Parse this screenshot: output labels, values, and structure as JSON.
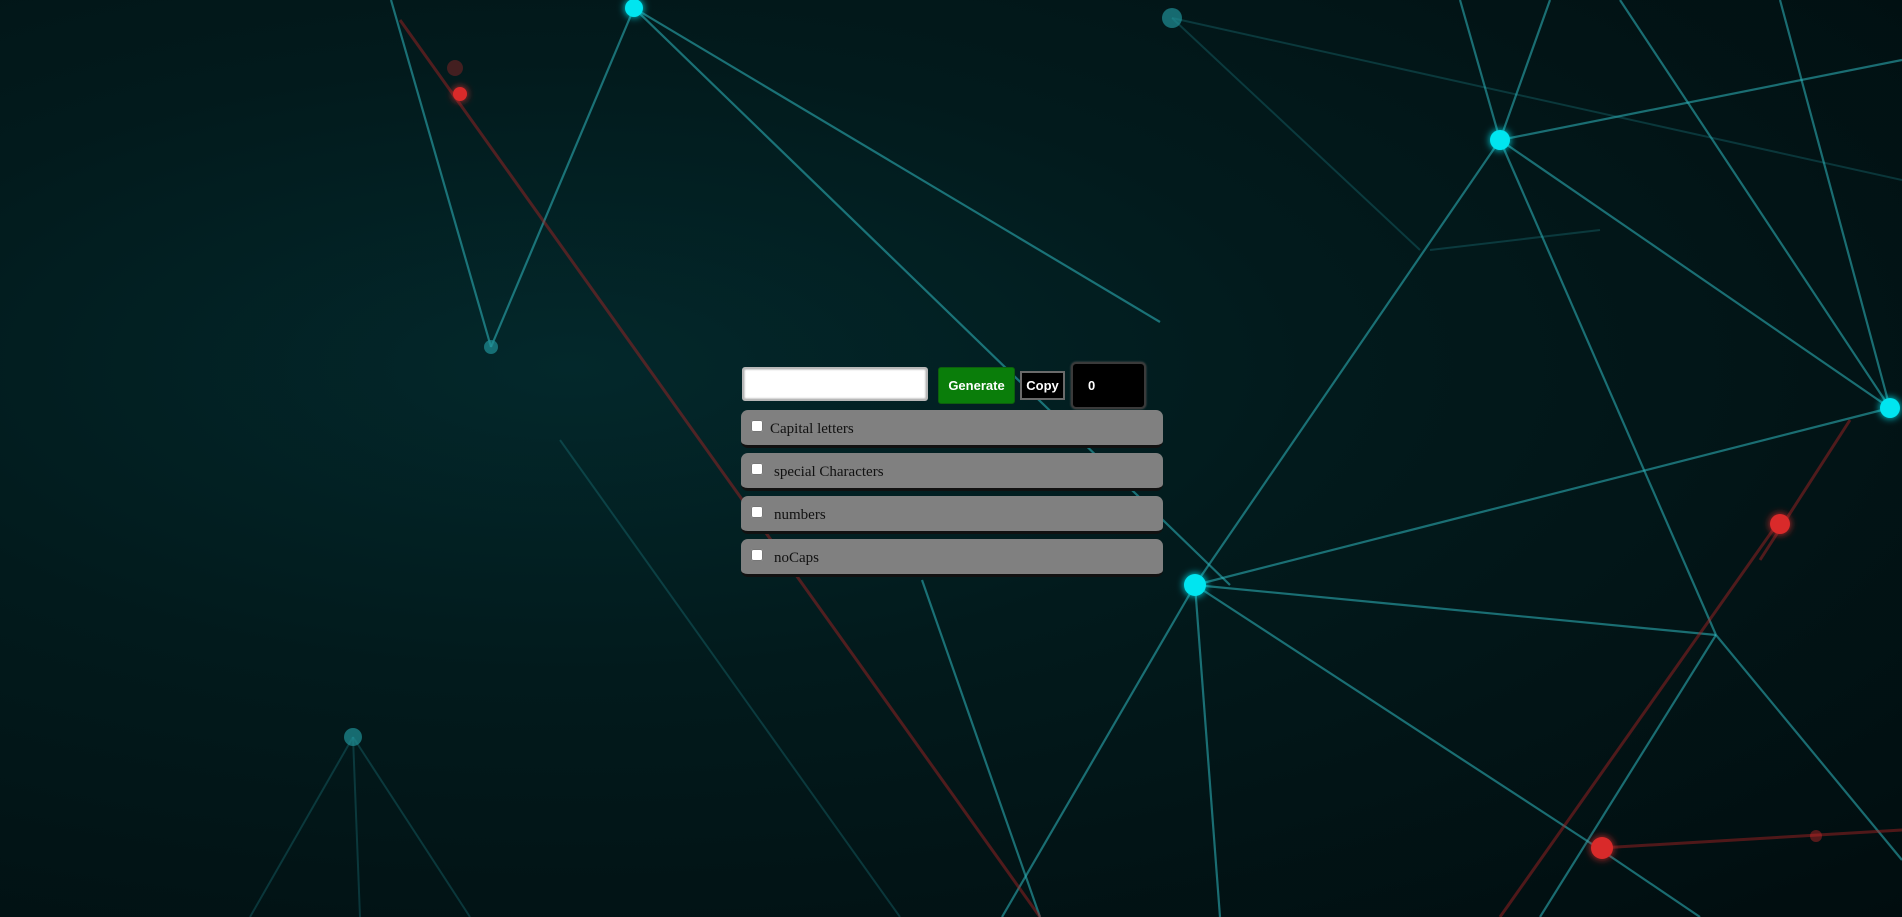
{
  "generator": {
    "password_value": "",
    "generate_label": "Generate",
    "copy_label": "Copy",
    "length_value": "0"
  },
  "options": [
    {
      "label": "Capital letters",
      "checked": false
    },
    {
      "label": "special Characters",
      "checked": false
    },
    {
      "label": "numbers",
      "checked": false
    },
    {
      "label": "noCaps",
      "checked": false
    }
  ],
  "colors": {
    "generate_button": "#0a7d0a",
    "option_background": "#808080",
    "background": "#021416",
    "network_node": "#00e5f0",
    "network_node_red": "#d92a2a"
  }
}
